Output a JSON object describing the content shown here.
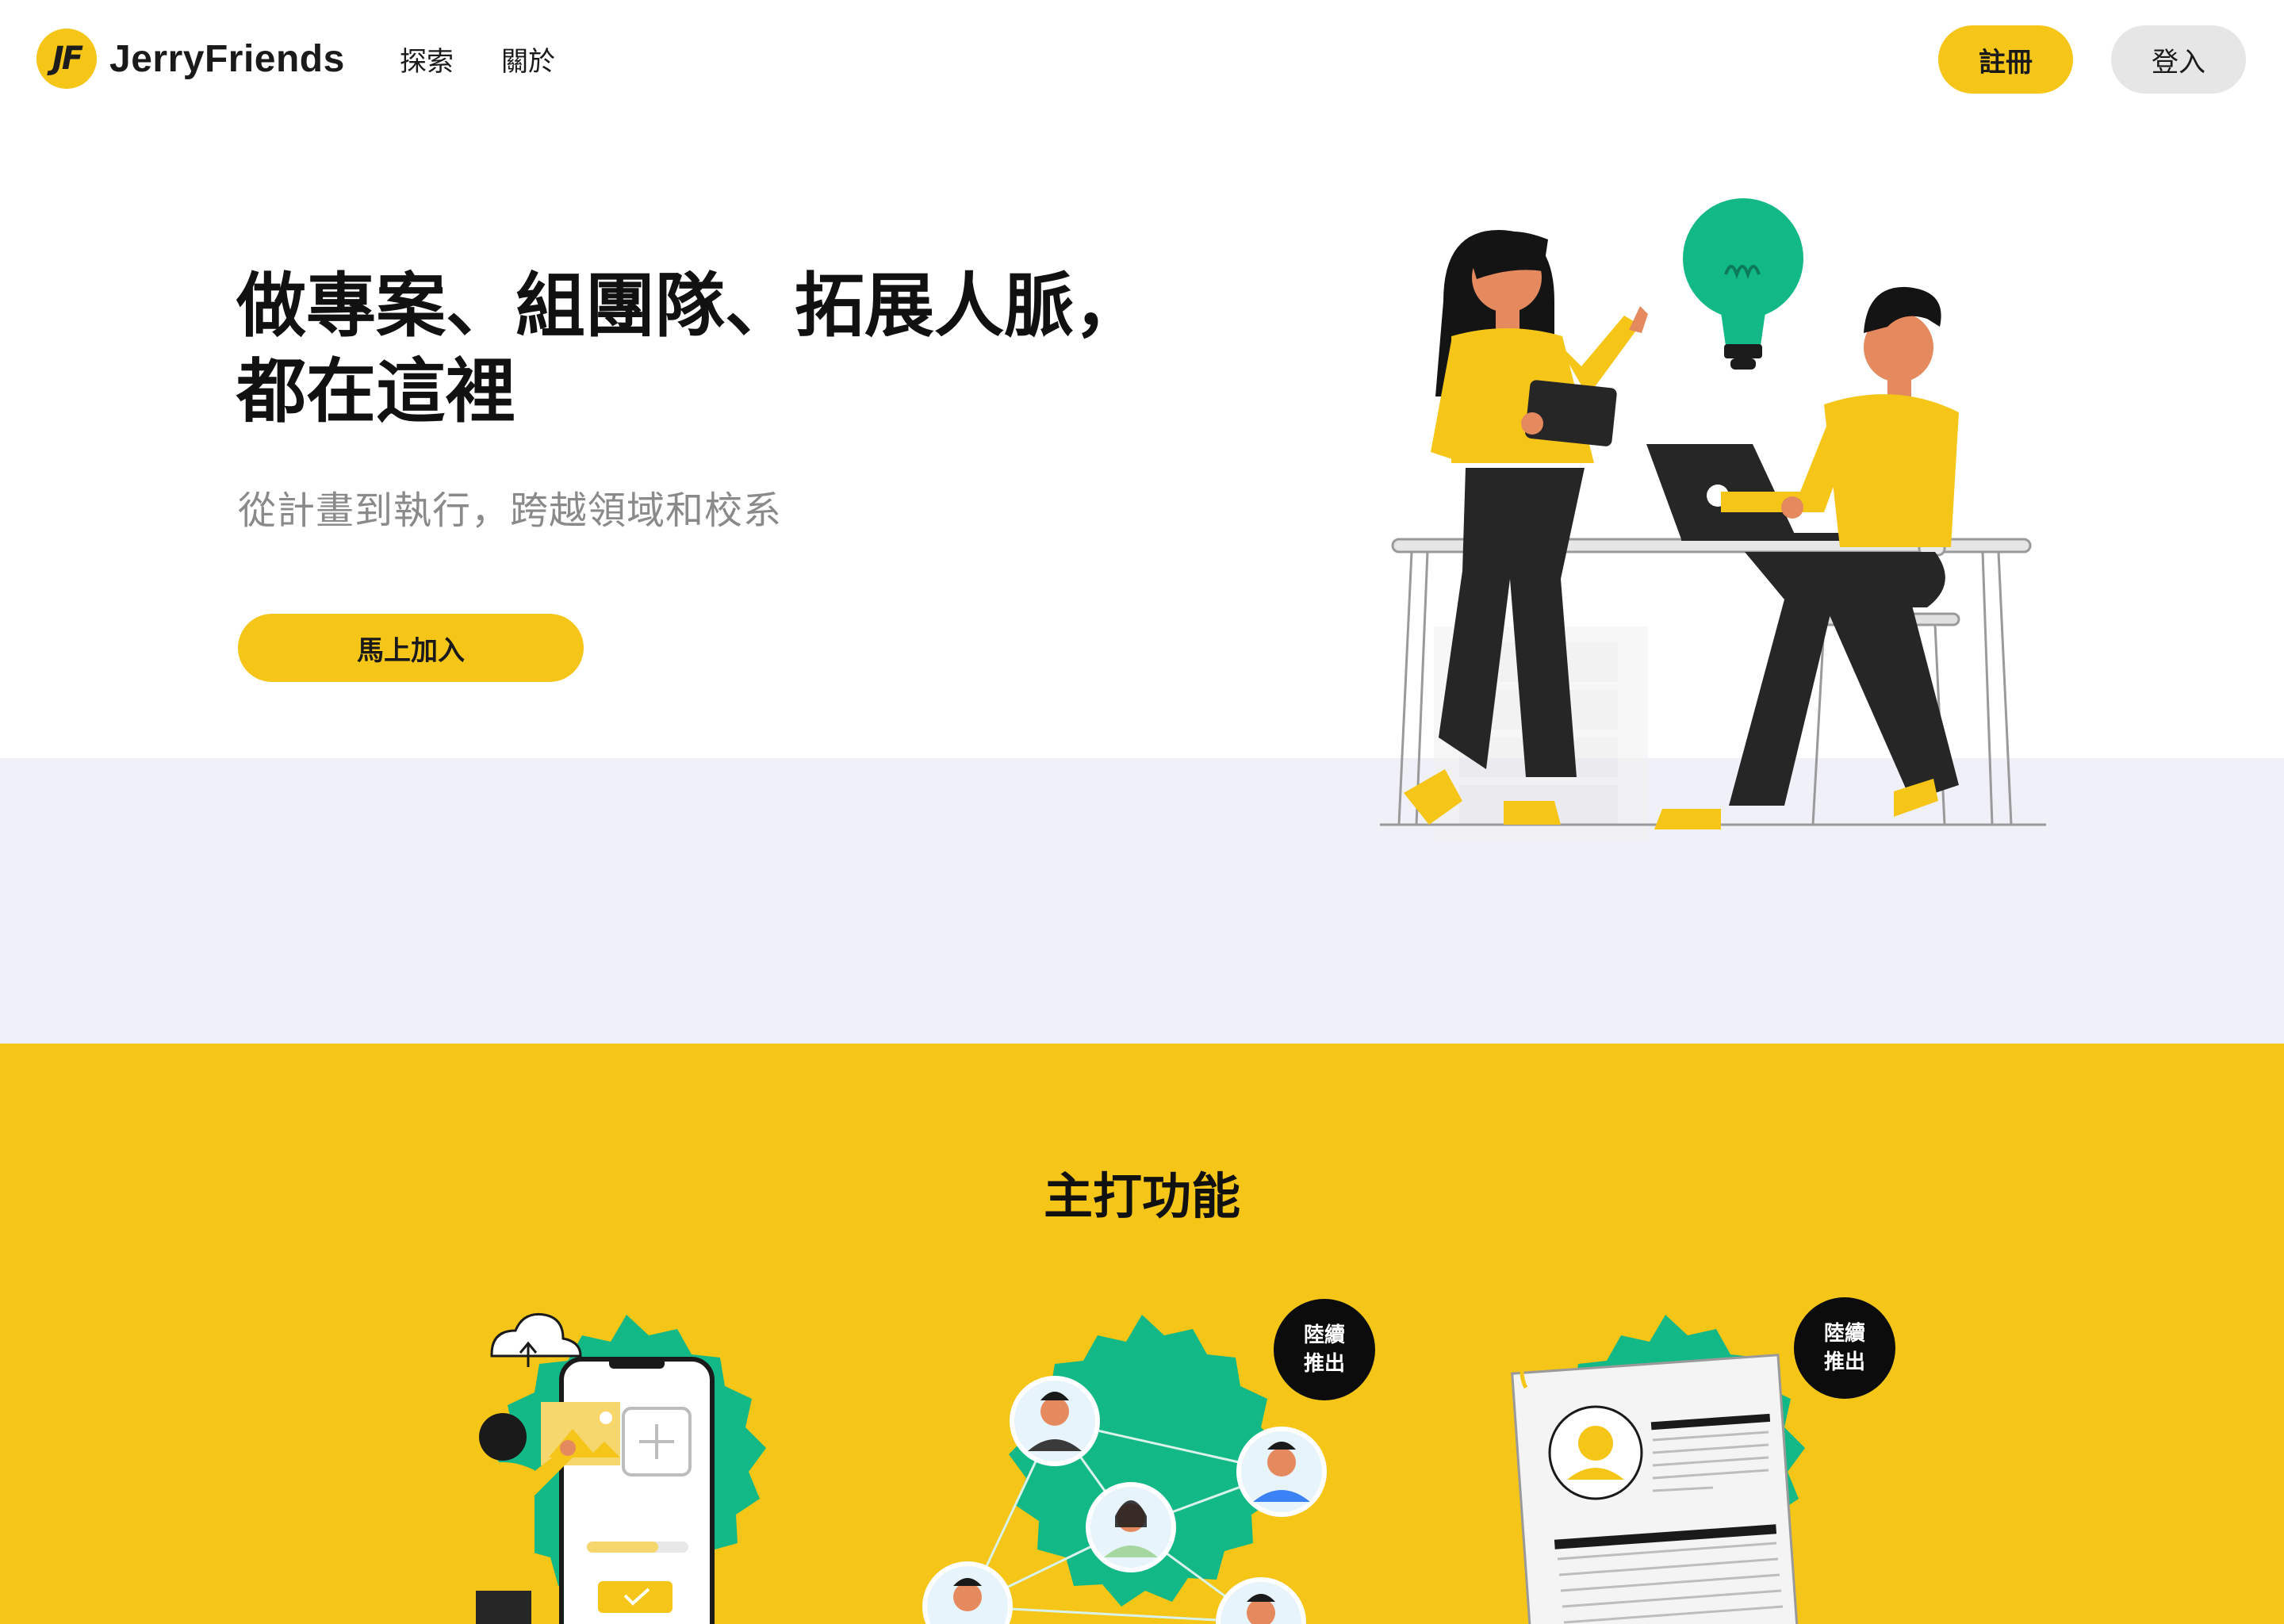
{
  "brand": {
    "logo_mark": "JF",
    "name": "JerryFriends"
  },
  "nav": {
    "explore": "探索",
    "about": "關於",
    "register": "註冊",
    "login": "登入"
  },
  "hero": {
    "title_line1": "做專案、組團隊、拓展人脈，",
    "title_line2": "都在這裡",
    "subtitle": "從計畫到執行，跨越領域和校系",
    "cta": "馬上加入"
  },
  "features": {
    "title": "主打功能",
    "coming_soon_line1": "陸續",
    "coming_soon_line2": "推出"
  },
  "colors": {
    "brand_yellow": "#F5C518",
    "accent_green": "#12B886",
    "band_lavender": "#F0F0F8"
  }
}
